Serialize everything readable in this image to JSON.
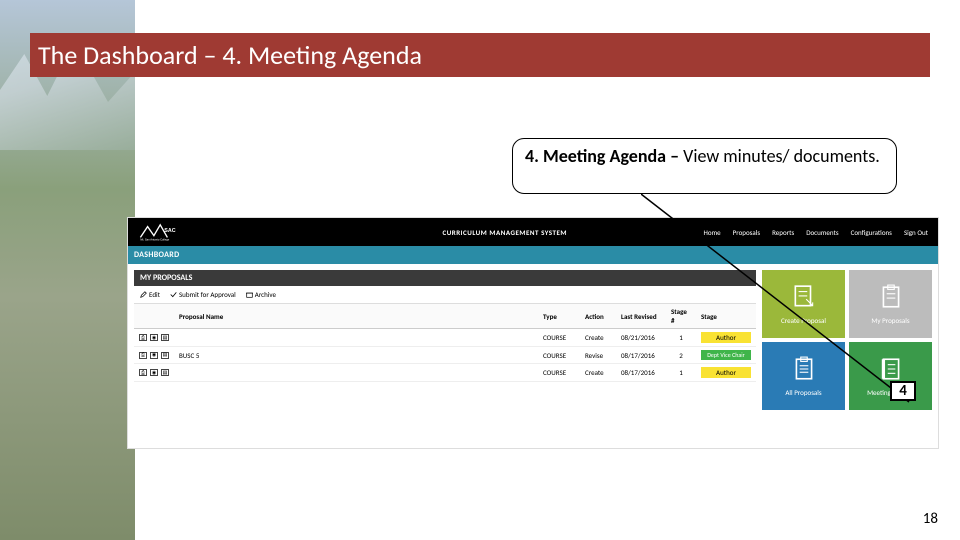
{
  "slide": {
    "title": "The Dashboard – 4. Meeting Agenda",
    "page_number": "18"
  },
  "callout": {
    "bold": "4. Meeting Agenda – ",
    "rest": "View minutes/ documents.",
    "label_number": "4"
  },
  "app": {
    "brand": "Mt. SAC",
    "brand_sub": "Mt. San Antonio College",
    "system_title": "CURRICULUM MANAGEMENT SYSTEM",
    "nav": [
      "Home",
      "Proposals",
      "Reports",
      "Documents",
      "Configurations",
      "Sign Out"
    ],
    "dashboard_label": "DASHBOARD",
    "my_proposals": {
      "header": "MY PROPOSALS",
      "tools": {
        "edit": "Edit",
        "submit": "Submit for Approval",
        "archive": "Archive"
      },
      "columns": [
        "",
        "Proposal Name",
        "Type",
        "Action",
        "Last Revised",
        "Stage #",
        "Stage"
      ],
      "rows": [
        {
          "name": "",
          "type": "COURSE",
          "action": "Create",
          "date": "08/21/2016",
          "stage_num": "1",
          "stage": "Author",
          "stage_cls": "stage-author"
        },
        {
          "name": "BUSC 5",
          "type": "COURSE",
          "action": "Revise",
          "date": "08/17/2016",
          "stage_num": "2",
          "stage": "Dept Vice Chair",
          "stage_cls": "stage-green"
        },
        {
          "name": "",
          "type": "COURSE",
          "action": "Create",
          "date": "08/17/2016",
          "stage_num": "1",
          "stage": "Author",
          "stage_cls": "stage-author"
        }
      ]
    },
    "tiles": {
      "create": "Create Proposal",
      "mine": "My Proposals",
      "all": "All Proposals",
      "agenda": "Meeting Agenda"
    }
  }
}
